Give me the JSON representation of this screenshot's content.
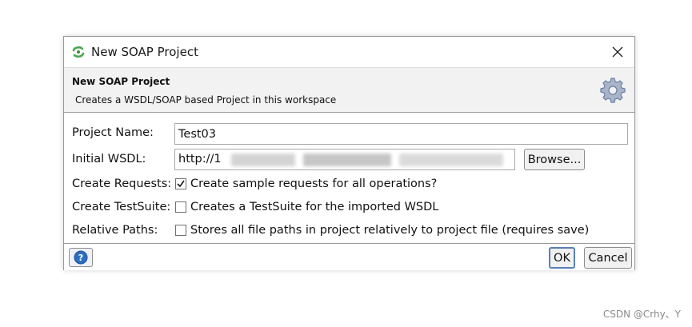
{
  "window": {
    "title": "New SOAP Project"
  },
  "header": {
    "title": "New SOAP Project",
    "description": "Creates a WSDL/SOAP based Project in this workspace"
  },
  "form": {
    "project_name_label": "Project Name:",
    "project_name_value": "Test03",
    "initial_wsdl_label": "Initial WSDL:",
    "initial_wsdl_value": "http://1",
    "browse_label": "Browse...",
    "create_requests_label": "Create Requests:",
    "create_requests_text": "Create sample requests for all operations?",
    "create_requests_checked": true,
    "create_testsuite_label": "Create TestSuite:",
    "create_testsuite_text": "Creates a TestSuite for the imported WSDL",
    "create_testsuite_checked": false,
    "relative_paths_label": "Relative Paths:",
    "relative_paths_text": "Stores all file paths in project relatively to project file (requires save)",
    "relative_paths_checked": false
  },
  "footer": {
    "ok_label": "OK",
    "cancel_label": "Cancel"
  },
  "watermark": "CSDN @Crhy、Y",
  "colors": {
    "icon_green": "#4aa84f",
    "help_blue": "#2f6fc1",
    "gear_blue": "#6b7fa6"
  },
  "icons": {
    "app": "soapui-icon",
    "close": "close-icon",
    "gear": "gear-icon",
    "help": "help-icon",
    "check": "checkmark-icon"
  }
}
